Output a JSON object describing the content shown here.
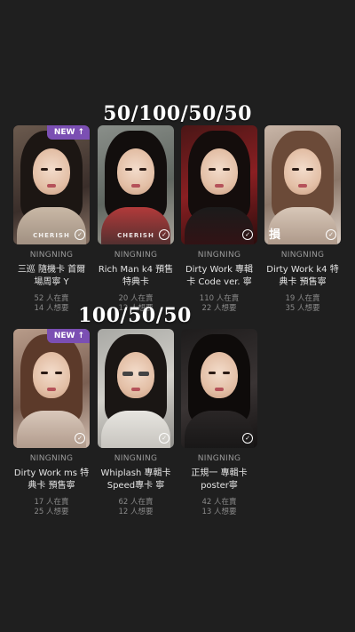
{
  "headings": {
    "top": "50/100/50/50",
    "bottom": "100/50/50"
  },
  "badge_text": "NEW",
  "cards": [
    {
      "artist": "NINGNING",
      "title": "三巡 隨機卡 首爾場周寧 Y",
      "selling": "52 人在賣",
      "wanting": "14 人想要",
      "watermark": "CHERISH",
      "new": true
    },
    {
      "artist": "NINGNING",
      "title": "Rich Man k4 預售 特典卡",
      "selling": "20 人在賣",
      "wanting": "12 人想要",
      "watermark": "CHERISH",
      "new": false
    },
    {
      "artist": "NINGNING",
      "title": "Dirty Work 專輯卡 Code ver. 寧",
      "selling": "110 人在賣",
      "wanting": "22 人想要",
      "watermark": "",
      "new": false
    },
    {
      "artist": "NINGNING",
      "title": "Dirty Work k4 特典卡 預售寧",
      "selling": "19 人在賣",
      "wanting": "35 人想要",
      "stamp": "損",
      "new": false
    },
    {
      "artist": "NINGNING",
      "title": "Dirty Work ms 特典卡 預售寧",
      "selling": "17 人在賣",
      "wanting": "25 人想要",
      "new": true
    },
    {
      "artist": "NINGNING",
      "title": "Whiplash 專輯卡 Speed專卡 寧",
      "selling": "62 人在賣",
      "wanting": "12 人想要",
      "new": false
    },
    {
      "artist": "NINGNING",
      "title": "正規一 專輯卡 poster寧",
      "selling": "42 人在賣",
      "wanting": "13 人想要",
      "new": false
    }
  ],
  "colors": {
    "background": "#1f1f1f",
    "badge": "#7b4fb3"
  },
  "icons": {
    "badge": "arrow-up-icon",
    "select": "check-circle-icon"
  }
}
